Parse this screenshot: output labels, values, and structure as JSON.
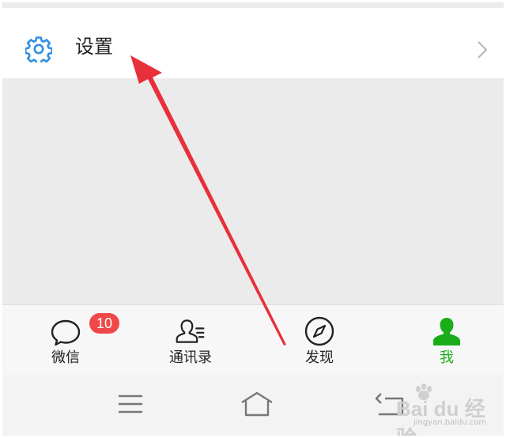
{
  "settings": {
    "label": "设置",
    "icon": "gear-icon"
  },
  "tabbar": {
    "active_color": "#1aad19",
    "tabs": [
      {
        "label": "微信",
        "icon": "chat-bubble-icon",
        "badge": "10"
      },
      {
        "label": "通讯录",
        "icon": "contacts-icon"
      },
      {
        "label": "发现",
        "icon": "compass-icon"
      },
      {
        "label": "我",
        "icon": "person-icon",
        "active": true
      }
    ]
  },
  "system_nav": {
    "buttons": [
      "menu-icon",
      "home-icon",
      "back-icon"
    ]
  },
  "watermark": {
    "text": "Bai du 经验",
    "sub": "jingyan.baidu.com"
  },
  "annotation": {
    "arrow_color": "#e8303a"
  }
}
